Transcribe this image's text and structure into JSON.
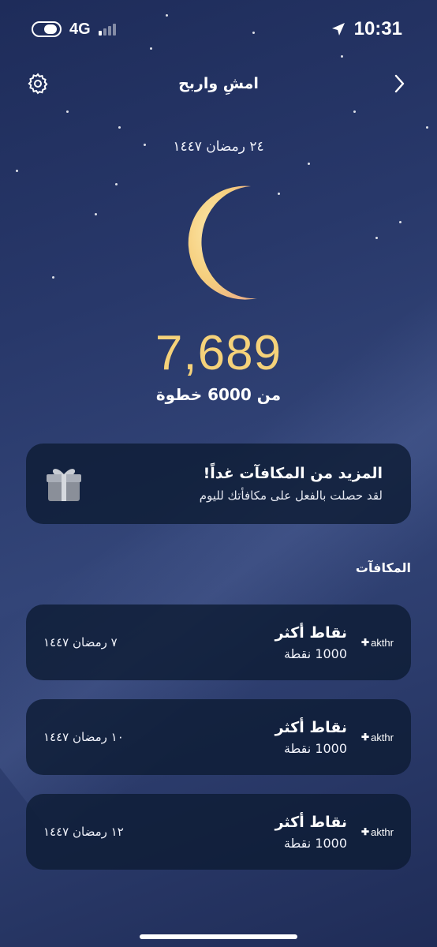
{
  "status_bar": {
    "network": "4G",
    "time": "10:31"
  },
  "header": {
    "title": "امشِ واربح"
  },
  "date": "٢٤ رمضان ١٤٤٧",
  "steps": {
    "count": "7,689",
    "goal_text": "من 6000 خطوة"
  },
  "banner": {
    "title": "المزيد من المكافآت غداً!",
    "subtitle": "لقد حصلت بالفعل على مكافأتك لليوم"
  },
  "rewards_section": {
    "title": "المكافآت"
  },
  "rewards": [
    {
      "brand": "akthr",
      "title": "نقاط أكثر",
      "points": "1000 نقطة",
      "date": "٧ رمضان ١٤٤٧"
    },
    {
      "brand": "akthr",
      "title": "نقاط أكثر",
      "points": "1000 نقطة",
      "date": "١٠ رمضان ١٤٤٧"
    },
    {
      "brand": "akthr",
      "title": "نقاط أكثر",
      "points": "1000 نقطة",
      "date": "١٢ رمضان ١٤٤٧"
    }
  ],
  "colors": {
    "accent": "#f5d27a",
    "card": "#0e1c34",
    "background": "#28386a"
  }
}
